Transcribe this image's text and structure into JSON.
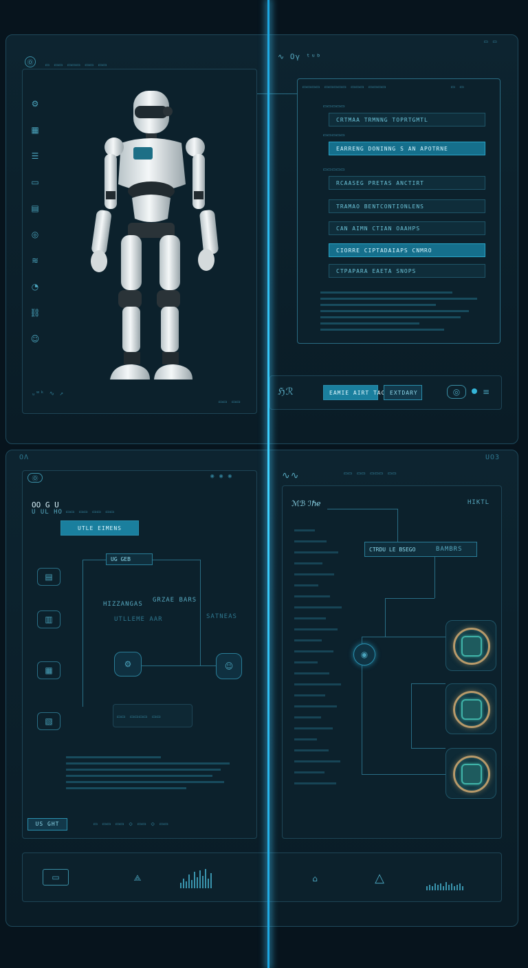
{
  "top_left": {
    "header": "Ⓞ",
    "sidebar_icons": [
      "settings-icon",
      "grid-icon",
      "list-icon",
      "folder-icon",
      "chart-icon",
      "target-icon",
      "layers-icon",
      "user-icon",
      "link-icon",
      "face-icon"
    ],
    "footer": "ᵤʷᵏ ∿ ↗"
  },
  "top_right": {
    "header": "∿ Oγ ᵗᵘᵇ",
    "header_right": "▭ ▭",
    "corner_label": "▭ ▭",
    "fields": [
      {
        "label": "▭▭▭▭▭",
        "value": "CRTMAA  TRMNNG  TOPRTGMTL",
        "active": false
      },
      {
        "label": "▭▭▭▭▭",
        "value": "EARRENG  DONINNG  S  AN APOTRNE",
        "active": true
      },
      {
        "label": "▭▭▭▭▭",
        "value": "RCAASEG  PRETAS  ANCTIRT",
        "active": false
      },
      {
        "label": "",
        "value": "TRAMAO  BENTCONTIONLENS",
        "active": false
      },
      {
        "label": "",
        "value": "CAN AIMN  CTIAN  OAAHPS",
        "active": false
      },
      {
        "label": "",
        "value": "CIORRE   CIPTADAIAPS  CNMRO",
        "active": true
      },
      {
        "label": "",
        "value": "CTPAPARA  EAETA  SNOPS",
        "active": false
      }
    ],
    "actions": {
      "logo": "ℌℛ",
      "primary": "EAMIE AIRT TACTS",
      "secondary": "EXTDARY"
    }
  },
  "bottom_left": {
    "header": "Ⓞ",
    "title": "OO  G  U",
    "subtitle": "U UL HO",
    "button": "UTLE EIMENS",
    "flow_node": "UG      GEB",
    "box_label_1": "HIZZANGAS",
    "box_label_2": "GRZAE BARS",
    "box_label_3": "UTLLEME AAR",
    "box_label_4": "SATNEAS",
    "footer_label": "US  GHT"
  },
  "bottom_right": {
    "header": "∿∿",
    "title": "ℳℬ  ℐℏℯ",
    "node_label": "CTRDU LE  BSEGO",
    "node_label_2": "BAMBRS",
    "header_right": "HIKTL",
    "chip_count": 3
  },
  "corner_tl": "Ⓞ",
  "corner_tr": "◫ ◫",
  "corner_bl": "OΛ",
  "corner_br": "UO3",
  "bottom_bar": {
    "icons": [
      "monitor-icon",
      "network-icon",
      "equalizer-icon",
      "home-icon",
      "warning-icon",
      "signal-icon"
    ]
  }
}
